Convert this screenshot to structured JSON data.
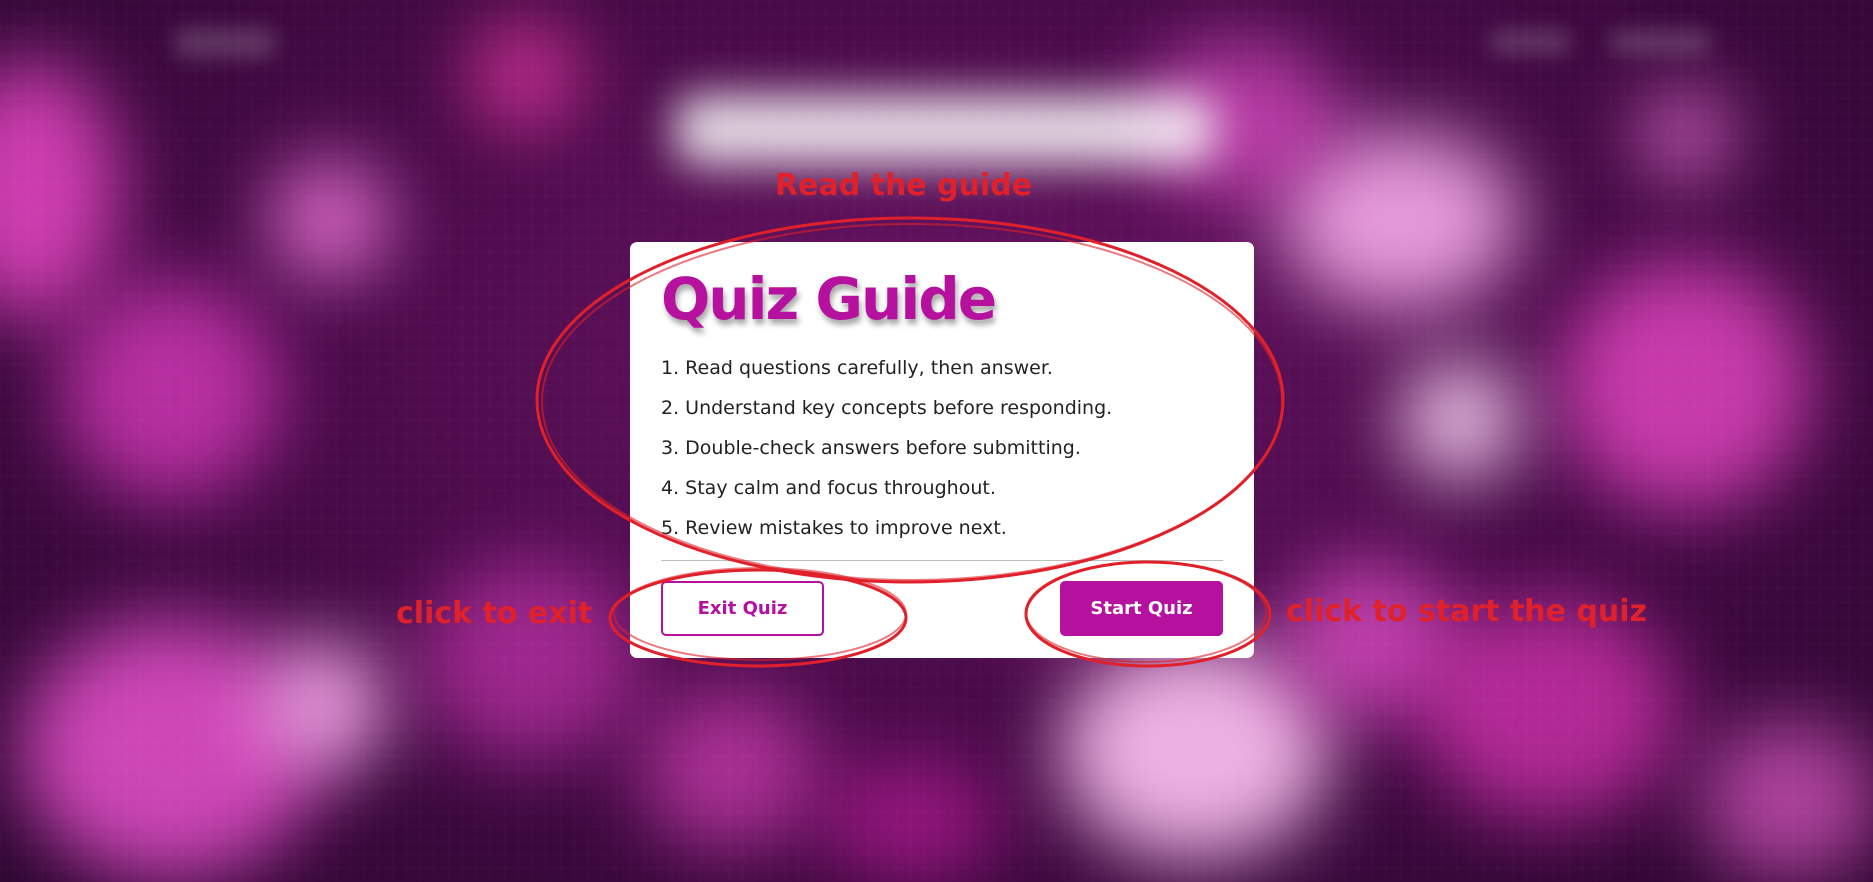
{
  "background": {
    "accent": "#b5119e",
    "base": "#4a0b4a"
  },
  "guide": {
    "title": "Quiz Guide",
    "rules": [
      "1. Read questions carefully, then answer.",
      "2. Understand key concepts before responding.",
      "3. Double-check answers before submitting.",
      "4. Stay calm and focus throughout.",
      "5. Review mistakes to improve next."
    ],
    "exit_label": "Exit Quiz",
    "start_label": "Start Quiz"
  },
  "annotations": {
    "read_guide": "Read the guide",
    "exit_hint": "click to exit",
    "start_hint": "click to start the quiz",
    "color": "#e0202a"
  }
}
